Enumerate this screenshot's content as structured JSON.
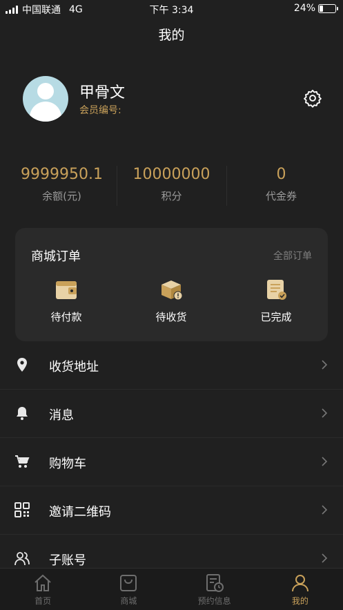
{
  "status_bar": {
    "carrier": "中国联通",
    "network": "4G",
    "time": "下午 3:34",
    "battery": "24%",
    "battery_level": 0.24
  },
  "header": {
    "title": "我的"
  },
  "profile": {
    "name": "甲骨文",
    "member_label": "会员编号:"
  },
  "stats": [
    {
      "value": "9999950.1",
      "label": "余额(元)"
    },
    {
      "value": "10000000",
      "label": "积分"
    },
    {
      "value": "0",
      "label": "代金券"
    }
  ],
  "orders": {
    "title": "商城订单",
    "all_label": "全部订单",
    "items": [
      {
        "label": "待付款",
        "icon": "wallet-icon"
      },
      {
        "label": "待收货",
        "icon": "package-icon"
      },
      {
        "label": "已完成",
        "icon": "completed-doc-icon"
      }
    ]
  },
  "menu": [
    {
      "label": "收货地址",
      "icon": "location-pin-icon"
    },
    {
      "label": "消息",
      "icon": "bell-icon"
    },
    {
      "label": "购物车",
      "icon": "cart-icon"
    },
    {
      "label": "邀请二维码",
      "icon": "qr-code-icon"
    },
    {
      "label": "子账号",
      "icon": "sub-account-icon"
    }
  ],
  "tabs": [
    {
      "label": "首页",
      "icon": "home-icon"
    },
    {
      "label": "商城",
      "icon": "shop-bag-icon"
    },
    {
      "label": "预约信息",
      "icon": "appointment-icon"
    },
    {
      "label": "我的",
      "icon": "profile-icon",
      "active": true
    }
  ],
  "colors": {
    "accent": "#c9a15a",
    "background": "#202020",
    "card": "#2a2a2a"
  }
}
